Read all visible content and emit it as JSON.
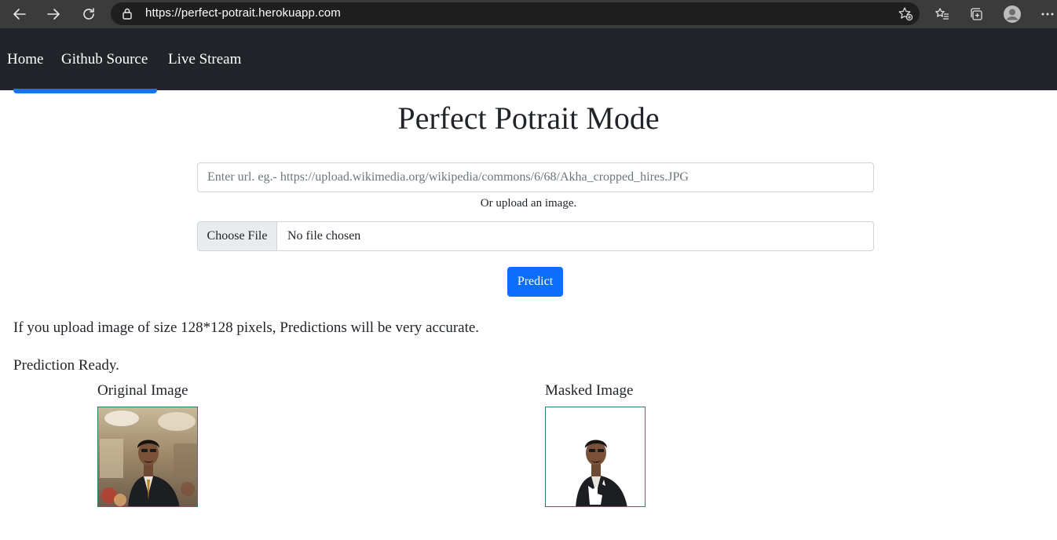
{
  "browser": {
    "url": "https://perfect-potrait.herokuapp.com",
    "icons": [
      "back-icon",
      "forward-icon",
      "refresh-icon",
      "lock-icon",
      "add-favorite-icon",
      "favorites-icon",
      "collections-icon",
      "profile-icon",
      "more-icon"
    ]
  },
  "navbar": {
    "links": [
      "Home",
      "Github Source",
      "Live Stream"
    ]
  },
  "main": {
    "title": "Perfect Potrait Mode",
    "url_placeholder": "Enter url. eg.- https://upload.wikimedia.org/wikipedia/commons/6/68/Akha_cropped_hires.JPG",
    "or_text": "Or upload an image.",
    "choose_file_label": "Choose File",
    "file_status": "No file chosen",
    "predict_label": "Predict",
    "note": "If you upload image of size 128*128 pixels, Predictions will be very accurate.",
    "status": "Prediction Ready.",
    "original_label": "Original Image",
    "masked_label": "Masked Image"
  },
  "colors": {
    "navbar_bg": "#212529",
    "primary": "#0d6efd",
    "chrome_bg": "#3b3b3b",
    "image_border": "#2e7d6a"
  }
}
